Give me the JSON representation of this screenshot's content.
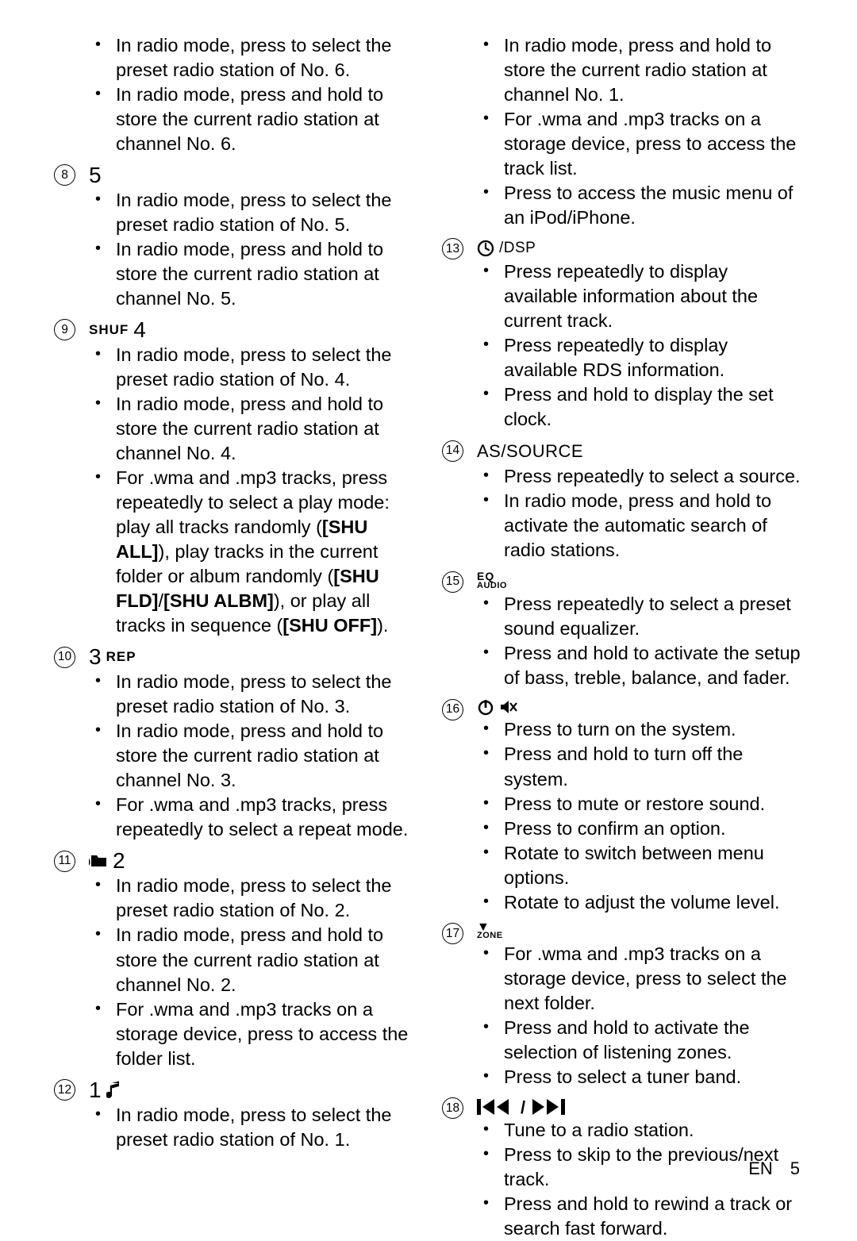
{
  "footer": {
    "lang": "EN",
    "page": "5"
  },
  "col1": [
    {
      "num": null,
      "bullets": [
        "In radio mode, press to select the preset radio station of No. 6.",
        "In radio mode, press and hold to store the current radio station at channel No. 6."
      ]
    },
    {
      "num": "8",
      "head_big": "5",
      "bullets": [
        "In radio mode, press to select the preset radio station of No. 5.",
        "In radio mode, press and hold to store the current radio station at channel No. 5."
      ]
    },
    {
      "num": "9",
      "head_small_pre": "SHUF",
      "head_big": "4",
      "bullets": [
        "In radio mode, press to select the preset radio station of No. 4.",
        "In radio mode, press and hold to store the current radio station at channel No. 4.",
        "For .wma and .mp3 tracks, press repeatedly to select a play mode: play all tracks randomly ([SHU ALL]), play tracks in the current folder or album randomly ([SHU FLD]/[SHU ALBM]), or play all tracks in sequence ([SHU OFF])."
      ]
    },
    {
      "num": "10",
      "head_big": "3",
      "head_small_post": "REP",
      "bullets": [
        "In radio mode, press to select the preset radio station of No. 3.",
        "In radio mode, press and hold to store the current radio station at channel No. 3.",
        "For .wma and .mp3 tracks, press repeatedly to select a repeat mode."
      ]
    },
    {
      "num": "11",
      "icon": "folder",
      "head_big": "2",
      "bullets": [
        "In radio mode, press to select the preset radio station of No. 2.",
        "In radio mode, press and hold to store the current radio station at channel No. 2.",
        "For .wma and .mp3 tracks on a storage device, press to access the folder list."
      ]
    },
    {
      "num": "12",
      "head_big": "1",
      "icon_post": "note",
      "bullets": [
        "In radio mode, press to select the preset radio station of No. 1."
      ]
    }
  ],
  "col2": [
    {
      "num": null,
      "bullets": [
        "In radio mode, press and hold to store the current radio station at channel No. 1.",
        "For .wma and .mp3 tracks on a storage device, press to access the track list.",
        "Press to access the music menu of an iPod/iPhone."
      ]
    },
    {
      "num": "13",
      "icon": "clock",
      "head_text": "/DSP",
      "bullets": [
        "Press repeatedly to display available information about the current track.",
        "Press repeatedly to display available RDS information.",
        "Press and hold to display the set clock."
      ]
    },
    {
      "num": "14",
      "head_text": "AS/SOURCE",
      "bullets": [
        "Press repeatedly to select a source.",
        "In radio mode, press and hold to activate the automatic search of radio stations."
      ]
    },
    {
      "num": "15",
      "stack": {
        "top": "EQ",
        "bot": "AUDIO"
      },
      "bullets": [
        "Press repeatedly to select a preset sound equalizer.",
        "Press and hold to activate the setup of bass, treble, balance, and fader."
      ]
    },
    {
      "num": "16",
      "dual_icon": [
        "power",
        "mute"
      ],
      "bullets": [
        "Press to turn on the system.",
        "Press and hold to turn off the system.",
        "Press to mute or restore sound.",
        "Press to confirm an option.",
        "Rotate to switch between menu options.",
        "Rotate to adjust the volume level."
      ]
    },
    {
      "num": "17",
      "stack": {
        "tri": "▼",
        "bot": "ZONE"
      },
      "bullets": [
        "For .wma and .mp3 tracks on a storage device, press to select the next folder.",
        "Press and hold to activate the selection of listening zones.",
        "Press to select a tuner band."
      ]
    },
    {
      "num": "18",
      "icon": "skip",
      "bullets": [
        "Tune to a radio station.",
        "Press to skip to the previous/next track.",
        "Press and hold to rewind a track or search fast forward."
      ]
    }
  ]
}
